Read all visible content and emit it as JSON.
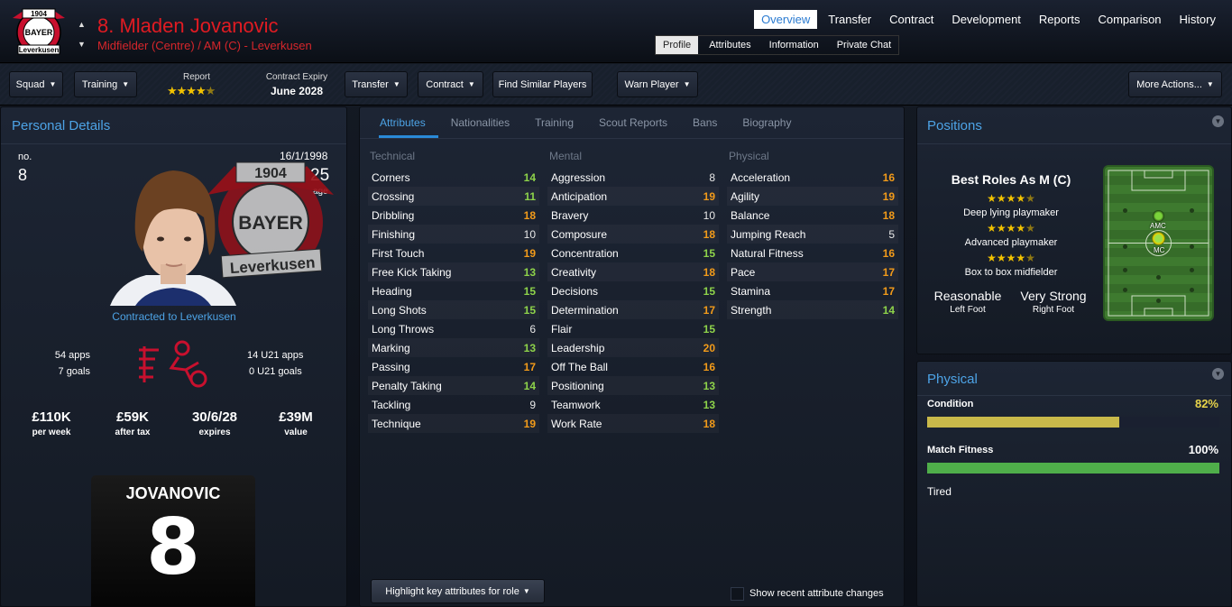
{
  "header": {
    "title": "8. Mladen Jovanovic",
    "subtitle": "Midfielder (Centre) / AM (C) - Leverkusen",
    "crest_text": {
      "year": "1904",
      "name": "BAYER",
      "club": "Leverkusen"
    },
    "nav": [
      "Overview",
      "Transfer",
      "Contract",
      "Development",
      "Reports",
      "Comparison",
      "History"
    ],
    "nav_active": "Overview",
    "subnav": [
      "Profile",
      "Attributes",
      "Information",
      "Private Chat"
    ],
    "subnav_active": "Profile"
  },
  "toolbar": {
    "squad": "Squad",
    "training": "Training",
    "report_label": "Report",
    "report_stars": 4.5,
    "contract_label": "Contract Expiry",
    "contract_value": "June 2028",
    "transfer": "Transfer",
    "contract": "Contract",
    "find_similar": "Find Similar Players",
    "warn_player": "Warn Player",
    "more_actions": "More Actions..."
  },
  "personal": {
    "title": "Personal Details",
    "no_label": "no.",
    "number": "8",
    "dob": "16/1/1998",
    "age": "25",
    "age_label": "age",
    "contracted": "Contracted to Leverkusen",
    "apps": "54 apps",
    "goals": "7 goals",
    "u21_apps": "14 U21 apps",
    "u21_goals": "0 U21 goals",
    "stats": [
      {
        "value": "£110K",
        "label": "per week"
      },
      {
        "value": "£59K",
        "label": "after tax"
      },
      {
        "value": "30/6/28",
        "label": "expires"
      },
      {
        "value": "£39M",
        "label": "value"
      }
    ],
    "shirt_name": "JOVANOVIC",
    "shirt_number": "8"
  },
  "attributes": {
    "tabs": [
      "Attributes",
      "Nationalities",
      "Training",
      "Scout Reports",
      "Bans",
      "Biography"
    ],
    "active_tab": "Attributes",
    "technical_label": "Technical",
    "mental_label": "Mental",
    "physical_label": "Physical",
    "technical": [
      {
        "name": "Corners",
        "value": "14"
      },
      {
        "name": "Crossing",
        "value": "11"
      },
      {
        "name": "Dribbling",
        "value": "18"
      },
      {
        "name": "Finishing",
        "value": "10"
      },
      {
        "name": "First Touch",
        "value": "19"
      },
      {
        "name": "Free Kick Taking",
        "value": "13"
      },
      {
        "name": "Heading",
        "value": "15"
      },
      {
        "name": "Long Shots",
        "value": "15"
      },
      {
        "name": "Long Throws",
        "value": "6"
      },
      {
        "name": "Marking",
        "value": "13"
      },
      {
        "name": "Passing",
        "value": "17"
      },
      {
        "name": "Penalty Taking",
        "value": "14"
      },
      {
        "name": "Tackling",
        "value": "9"
      },
      {
        "name": "Technique",
        "value": "19"
      }
    ],
    "mental": [
      {
        "name": "Aggression",
        "value": "8"
      },
      {
        "name": "Anticipation",
        "value": "19"
      },
      {
        "name": "Bravery",
        "value": "10"
      },
      {
        "name": "Composure",
        "value": "18"
      },
      {
        "name": "Concentration",
        "value": "15"
      },
      {
        "name": "Creativity",
        "value": "18"
      },
      {
        "name": "Decisions",
        "value": "15"
      },
      {
        "name": "Determination",
        "value": "17"
      },
      {
        "name": "Flair",
        "value": "15"
      },
      {
        "name": "Leadership",
        "value": "20"
      },
      {
        "name": "Off The Ball",
        "value": "16"
      },
      {
        "name": "Positioning",
        "value": "13"
      },
      {
        "name": "Teamwork",
        "value": "13"
      },
      {
        "name": "Work Rate",
        "value": "18"
      }
    ],
    "physical": [
      {
        "name": "Acceleration",
        "value": "16"
      },
      {
        "name": "Agility",
        "value": "19"
      },
      {
        "name": "Balance",
        "value": "18"
      },
      {
        "name": "Jumping Reach",
        "value": "5"
      },
      {
        "name": "Natural Fitness",
        "value": "16"
      },
      {
        "name": "Pace",
        "value": "17"
      },
      {
        "name": "Stamina",
        "value": "17"
      },
      {
        "name": "Strength",
        "value": "14"
      }
    ],
    "highlight_btn": "Highlight key attributes for role",
    "show_recent": "Show recent attribute changes"
  },
  "positions": {
    "title": "Positions",
    "best_roles_title": "Best Roles As M (C)",
    "roles": [
      {
        "name": "Deep lying playmaker",
        "stars": 4.5
      },
      {
        "name": "Advanced playmaker",
        "stars": 4.5
      },
      {
        "name": "Box to box midfielder",
        "stars": 4.5
      }
    ],
    "left_foot": "Reasonable",
    "left_foot_label": "Left Foot",
    "right_foot": "Very Strong",
    "right_foot_label": "Right Foot",
    "pitch_labels": [
      "AMC",
      "MC"
    ]
  },
  "physical": {
    "title": "Physical",
    "condition_label": "Condition",
    "condition_value": "82%",
    "condition_pct": 82,
    "match_fitness_label": "Match Fitness",
    "match_fitness_value": "100%",
    "match_fitness_pct": 100,
    "status": "Tired"
  },
  "colors": {
    "title_red": "#e01b22",
    "accent_blue": "#4da3e6",
    "star_gold": "#f2c200",
    "attr_green": "#8ed34a",
    "attr_yellow": "#e8c200",
    "attr_orange": "#f29b1a",
    "condition_bar": "#c9b94a",
    "fitness_bar": "#4fae4a"
  }
}
